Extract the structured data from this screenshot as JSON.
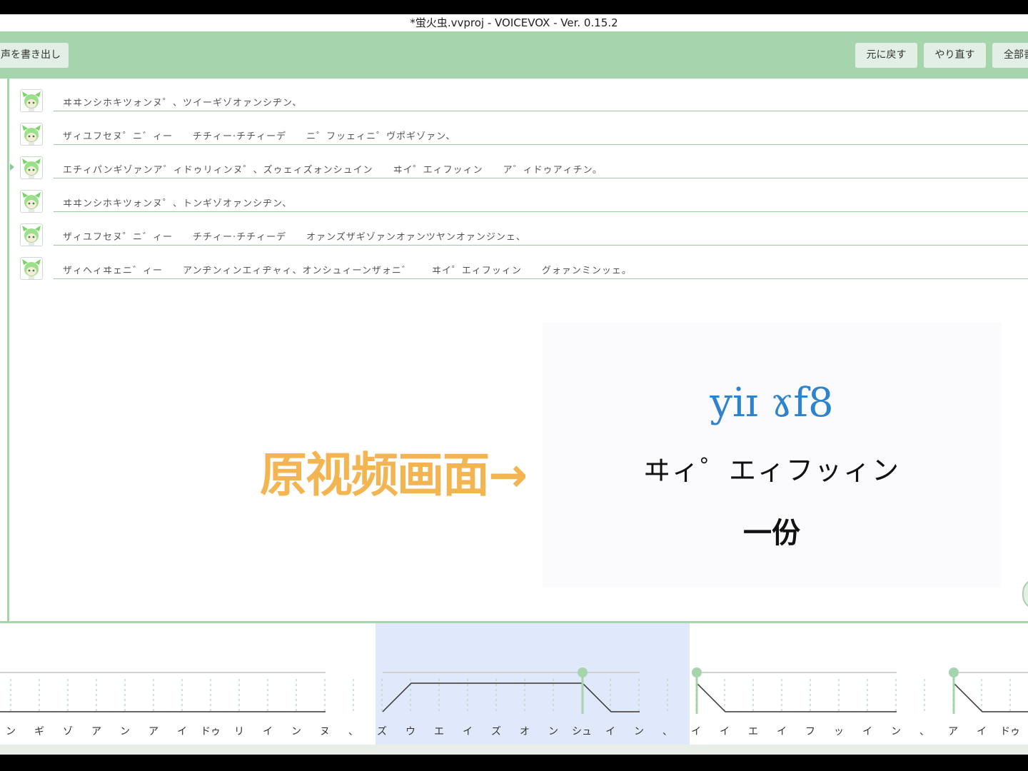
{
  "window": {
    "title": "*蛍火虫.vvproj - VOICEVOX - Ver. 0.15.2"
  },
  "toolbar": {
    "export_label": "声を書き出し",
    "undo_label": "元に戻す",
    "redo_label": "やり直す",
    "all_label": "全部書"
  },
  "rows": [
    {
      "text": "ヰヰンシホキツォンヌ゜、ツイーギゾオァンシヂン、"
    },
    {
      "text": "ザィユフセヌ゜ニ゛ィー　　チチィー·チチィーデ　　ニ゜フッェィニ゜ヴポギゾァン、"
    },
    {
      "text": "エチィパンギゾァンア゛ィドゥリィンヌ゜、ズゥェィズォンシュイン　　ヰイ゜エィフッィン　　ア゛ィドゥアィチン。",
      "active": true
    },
    {
      "text": "ヰヰンシホキツォンヌ゜、トンギゾオァンシヂン、"
    },
    {
      "text": "ザィユフセヌ゜ニ゛ィー　　チチィー·チチィーデ　　オァンズザギゾァンオァンツヤンオァンジンェ、"
    },
    {
      "text": "ザィヘィヰェニ゛ィー　　アンヂンィンエィヂャィ、オンシュィーンザォニ゛　　ヰイ゜エィフッィン　　グォァンミンッェ。"
    }
  ],
  "overlay": {
    "label": "原视频画面→"
  },
  "video": {
    "ipa": "yiɪ ɤf8",
    "kana": "ヰィ゜エィフッィン",
    "chinese": "一份"
  },
  "moras": [
    "ン",
    "ギ",
    "ゾ",
    "ア",
    "ン",
    "ア",
    "イ",
    "ドゥ",
    "リ",
    "イ",
    "ン",
    "ヌ",
    "、",
    "ズ",
    "ウ",
    "エ",
    "イ",
    "ズ",
    "オ",
    "ン",
    "シュ",
    "イ",
    "ン",
    "、",
    "イ",
    "イ",
    "エ",
    "イ",
    "フ",
    "ッ",
    "イ",
    "ン",
    "、",
    "ア",
    "イ",
    "ドゥ"
  ],
  "colors": {
    "accent": "#a5d4ad",
    "overlay": "#f3b552",
    "ipa": "#2f83cc",
    "highlight": "#e0e9fb"
  }
}
